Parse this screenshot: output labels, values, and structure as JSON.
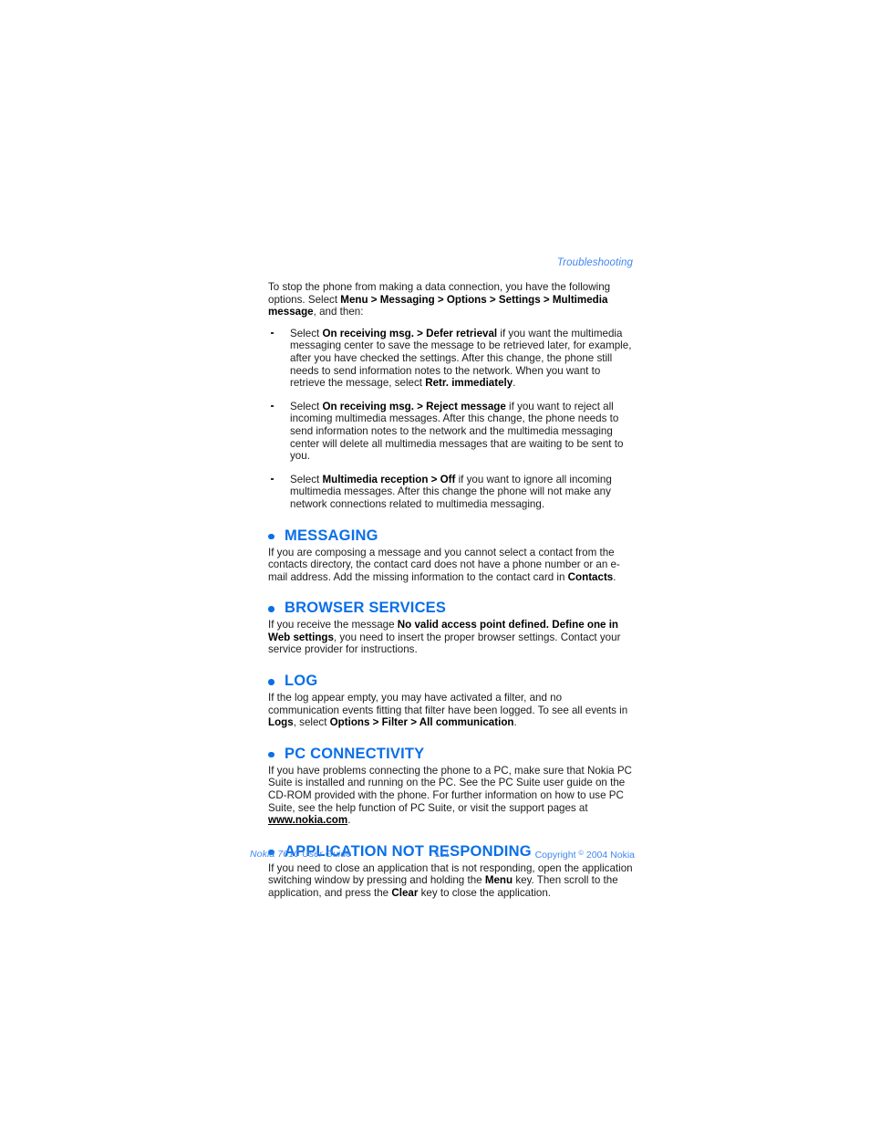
{
  "document": {
    "running_header": "Troubleshooting",
    "intro": {
      "line1": "To stop the phone from making a data connection, you have the following options.",
      "line2_prefix": "Select ",
      "line2_bold": "Menu > Messaging > Options > Settings > Multimedia message",
      "line2_suffix": ", and then:"
    },
    "bullets": [
      {
        "prefix": "Select ",
        "bold1": "On receiving msg. > Defer retrieval",
        "mid": " if you want the multimedia messaging center to save the message to be retrieved later, for example, after you have checked the settings. After this change, the phone still needs to send information notes to the network. When you want to retrieve the message, select ",
        "bold2": "Retr. immediately",
        "suffix": "."
      },
      {
        "prefix": "Select ",
        "bold1": "On receiving msg. > Reject message",
        "mid": " if you want to reject all incoming multimedia messages. After this change, the phone needs to send information notes to the network and the multimedia messaging center will delete all multimedia messages that are waiting to be sent to you.",
        "bold2": "",
        "suffix": ""
      },
      {
        "prefix": "Select ",
        "bold1": "Multimedia reception > Off",
        "mid": " if you want to ignore all incoming multimedia messages. After this change the phone will not make any network connections related to multimedia messaging.",
        "bold2": "",
        "suffix": ""
      }
    ],
    "sections": [
      {
        "heading": "MESSAGING",
        "body_prefix": "If you are composing a message and you cannot select a contact from the contacts directory, the contact card does not have a phone number or an e-mail address. Add the missing information to the contact card in ",
        "body_bold": "Contacts",
        "body_suffix": "."
      },
      {
        "heading": "BROWSER SERVICES",
        "body_prefix": "If you receive the message ",
        "body_bold": "No valid access point defined. Define one in Web settings",
        "body_suffix": ", you need to insert the proper browser settings. Contact your service provider for instructions."
      },
      {
        "heading": "LOG",
        "body_prefix": "If the log appear empty, you may have activated a filter, and no communication events fitting that filter have been logged. To see all events in ",
        "body_bold": "Logs",
        "body_mid": ", select ",
        "body_bold2": "Options > Filter > All communication",
        "body_suffix": "."
      },
      {
        "heading": "PC CONNECTIVITY",
        "body_prefix": "If you have problems connecting the phone to a PC, make sure that Nokia PC Suite is installed and running on the PC. See the PC Suite user guide on the CD-ROM provided with the phone. For further information on how to use PC Suite, see the help function of PC Suite, or visit the support pages at ",
        "body_link": "www.nokia.com",
        "body_suffix": "."
      },
      {
        "heading": "APPLICATION NOT RESPONDING",
        "body_prefix": "If you need to close an application that is not responding, open the application switching window by pressing and holding the ",
        "body_bold": "Menu",
        "body_mid": " key. Then scroll to the application, and press the ",
        "body_bold2": "Clear",
        "body_suffix": " key to close the application."
      }
    ],
    "footer": {
      "left": "Nokia 7610 User Guide",
      "center": "111",
      "right_prefix": "Copyright ",
      "right_symbol": "©",
      "right_suffix": " 2004 Nokia"
    },
    "colors": {
      "accent_blue": "#0a6fe8",
      "footer_blue": "#3f86f2",
      "body_text": "#1b1b1b"
    }
  }
}
